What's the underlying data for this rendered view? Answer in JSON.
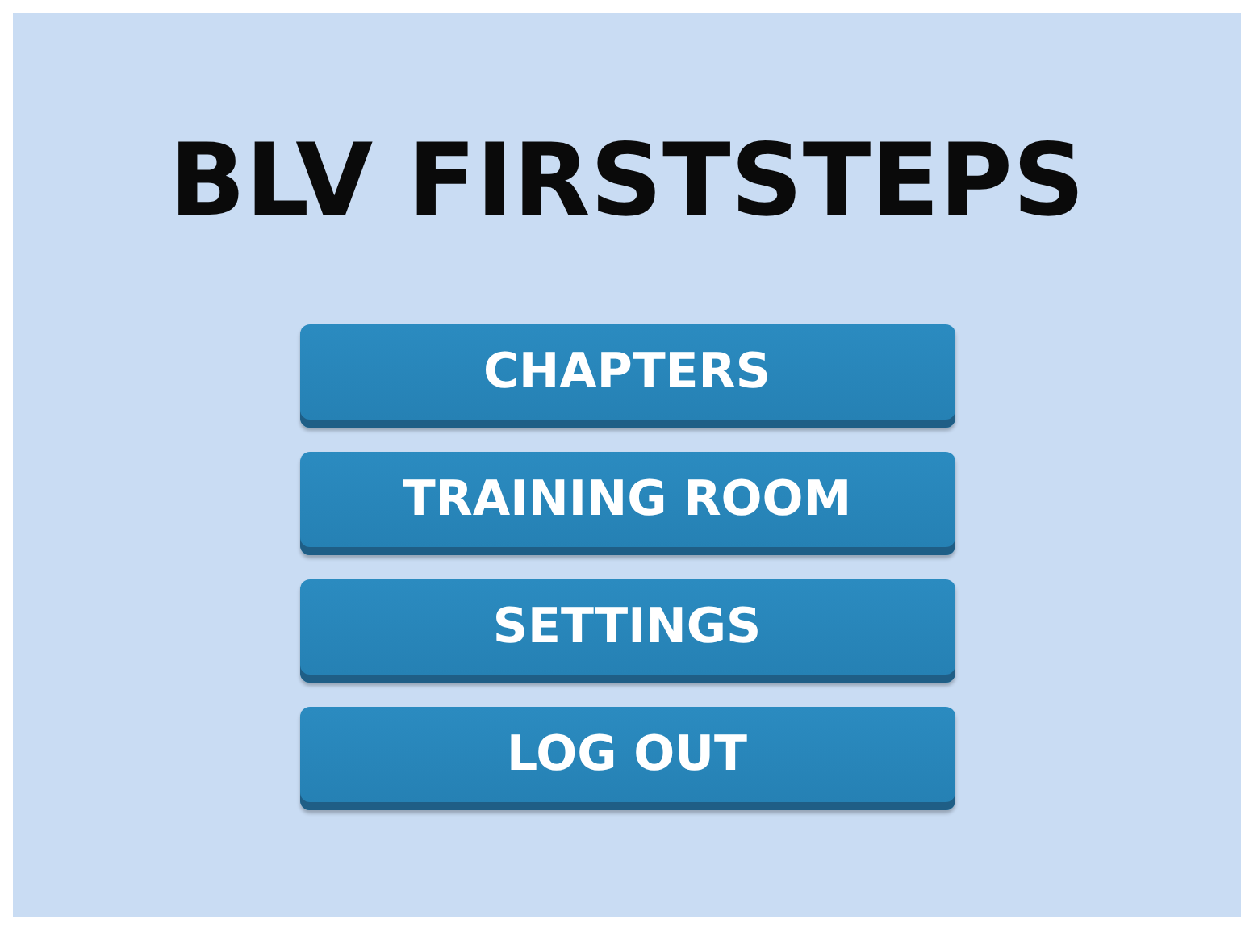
{
  "title": "BLV FIRSTSTEPS",
  "menu": [
    {
      "label": "CHAPTERS"
    },
    {
      "label": "TRAINING ROOM"
    },
    {
      "label": "SETTINGS"
    },
    {
      "label": "LOG OUT"
    }
  ]
}
